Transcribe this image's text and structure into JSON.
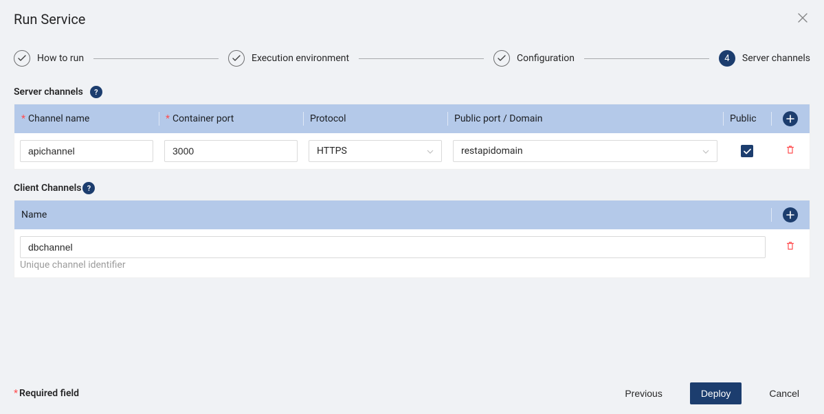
{
  "dialog": {
    "title": "Run Service"
  },
  "stepper": {
    "steps": [
      {
        "label": "How to run",
        "state": "completed"
      },
      {
        "label": "Execution environment",
        "state": "completed"
      },
      {
        "label": "Configuration",
        "state": "completed"
      },
      {
        "label": "Server channels",
        "state": "active",
        "number": "4"
      }
    ]
  },
  "server_channels": {
    "title": "Server channels",
    "headers": {
      "channel_name": "Channel name",
      "container_port": "Container port",
      "protocol": "Protocol",
      "public_port": "Public port / Domain",
      "public": "Public"
    },
    "row": {
      "channel_name": "apichannel",
      "container_port": "3000",
      "protocol": "HTTPS",
      "domain": "restapidomain",
      "public_checked": true
    }
  },
  "client_channels": {
    "title": "Client Channels",
    "headers": {
      "name": "Name"
    },
    "row": {
      "name": "dbchannel"
    },
    "hint": "Unique channel identifier"
  },
  "footer": {
    "required_label": "Required field",
    "previous": "Previous",
    "deploy": "Deploy",
    "cancel": "Cancel"
  }
}
